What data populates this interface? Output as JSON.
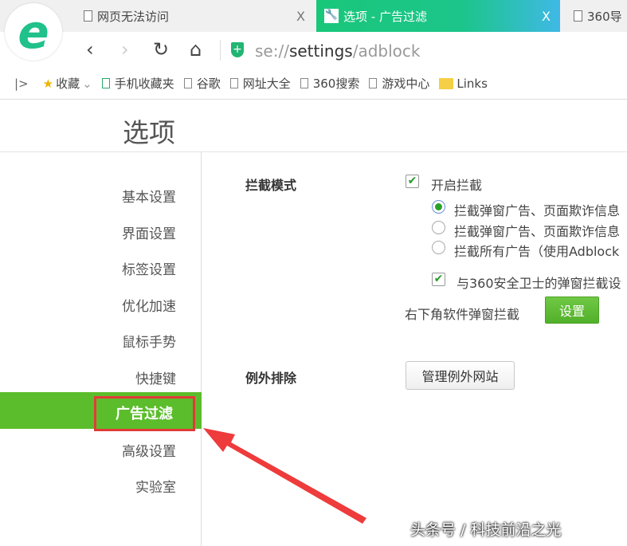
{
  "tabs": [
    {
      "label": "网页无法访问",
      "close": "X"
    },
    {
      "label": "选项 - 广告过滤",
      "close": "X"
    },
    {
      "label": "360导"
    }
  ],
  "address": {
    "scheme": "se://",
    "host": "settings",
    "path": "/adblock"
  },
  "bookmarks": [
    "收藏",
    "手机收藏夹",
    "谷歌",
    "网址大全",
    "360搜索",
    "游戏中心",
    "Links"
  ],
  "page_title": "选项",
  "sidebar": [
    "基本设置",
    "界面设置",
    "标签设置",
    "优化加速",
    "鼠标手势",
    "快捷键",
    "广告过滤",
    "高级设置",
    "实验室"
  ],
  "block_mode": {
    "label": "拦截模式",
    "enable": "开启拦截",
    "options": [
      "拦截弹窗广告、页面欺诈信息",
      "拦截弹窗广告、页面欺诈信息",
      "拦截所有广告（使用Adblock"
    ],
    "selected": 0,
    "sync": "与360安全卫士的弹窗拦截设",
    "corner": "右下角软件弹窗拦截",
    "settings_btn": "设置"
  },
  "exceptions": {
    "label": "例外排除",
    "manage_btn": "管理例外网站"
  },
  "watermark": "头条号 / 科技前沿之光"
}
